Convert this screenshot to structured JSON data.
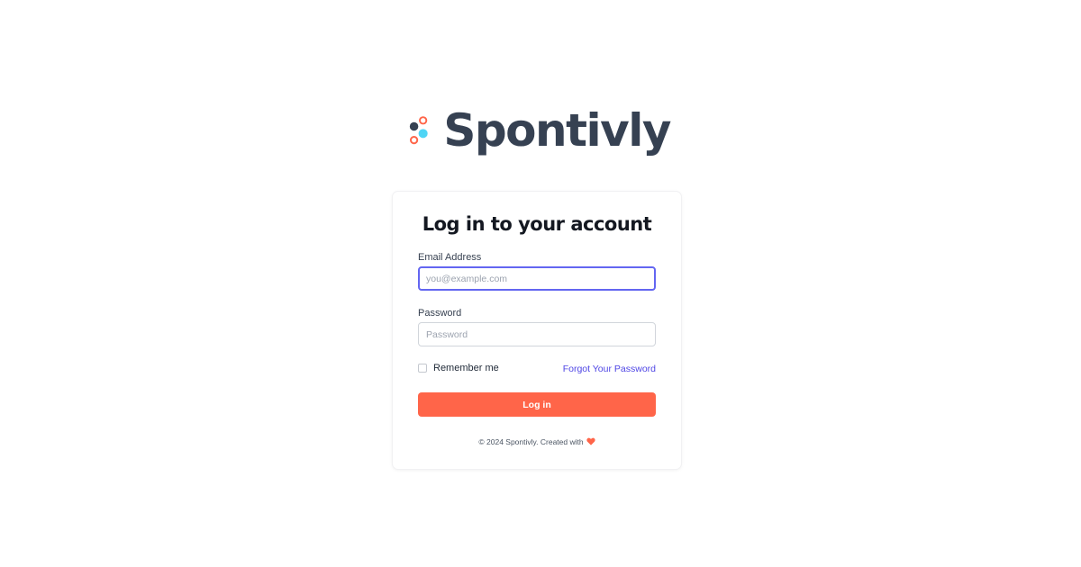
{
  "brand": {
    "name": "Spontivly",
    "logo_icon": "spontivly-dots-logo",
    "colors": {
      "text": "#364152",
      "coral": "#ff6549",
      "cyan": "#4fd5f5",
      "dark": "#364152"
    }
  },
  "login_form": {
    "title": "Log in to your account",
    "email": {
      "label": "Email Address",
      "placeholder": "you@example.com",
      "value": ""
    },
    "password": {
      "label": "Password",
      "placeholder": "Password",
      "value": ""
    },
    "remember_me": {
      "label": "Remember me",
      "checked": false
    },
    "forgot_password_label": "Forgot Your Password",
    "submit_label": "Log in"
  },
  "footer": {
    "text": "© 2024 Spontivly. Created with",
    "icon": "heart-icon"
  },
  "colors": {
    "accent_button": "#ff6549",
    "link": "#4f46e5",
    "focus_ring": "#6366f1"
  }
}
